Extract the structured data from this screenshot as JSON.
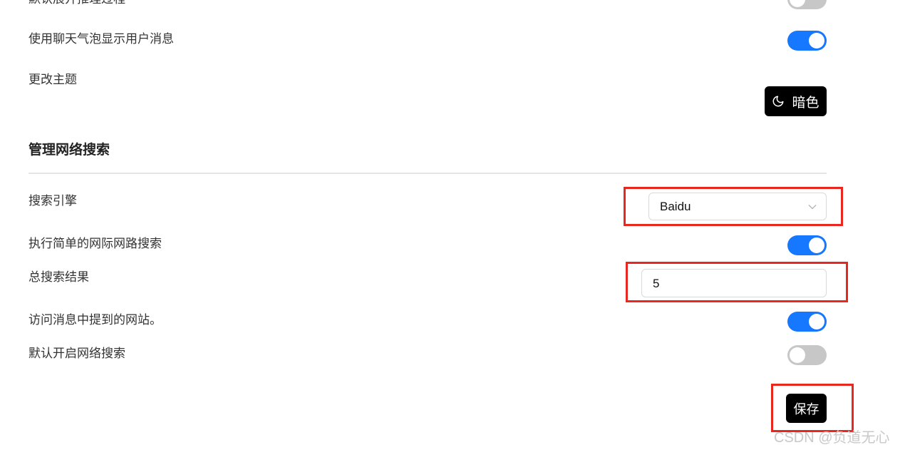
{
  "settings": {
    "top": {
      "show_reasoning_label": "默认展开推理过程",
      "show_reasoning_on": false,
      "chat_bubble_label": "使用聊天气泡显示用户消息",
      "chat_bubble_on": true,
      "theme_label": "更改主题",
      "theme_button_label": "暗色",
      "theme_icon": "moon-icon"
    },
    "web_search": {
      "section_title": "管理网络搜索",
      "engine_label": "搜索引擎",
      "engine_value": "Baidu",
      "engine_icon": "chevron-down-icon",
      "simple_search_label": "执行简单的网际网路搜索",
      "simple_search_on": true,
      "total_results_label": "总搜索结果",
      "total_results_value": "5",
      "visit_sites_label": "访问消息中提到的网站。",
      "visit_sites_on": true,
      "default_search_label": "默认开启网络搜索",
      "default_search_on": false
    },
    "save_label": "保存"
  },
  "watermark": "CSDN @负道无心",
  "colors": {
    "toggle_on": "#1677ff",
    "toggle_off": "#c7c7c7",
    "highlight": "#e8281e",
    "button_bg": "#000000"
  }
}
